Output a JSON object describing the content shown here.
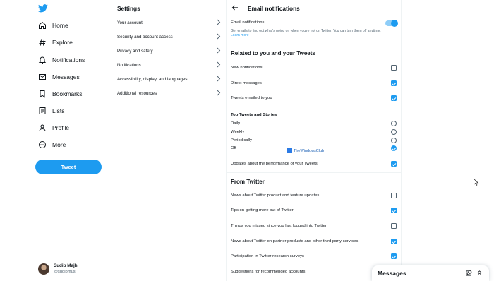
{
  "nav": {
    "items": [
      {
        "label": "Home",
        "icon": "home-icon"
      },
      {
        "label": "Explore",
        "icon": "hashtag-icon"
      },
      {
        "label": "Notifications",
        "icon": "bell-icon"
      },
      {
        "label": "Messages",
        "icon": "envelope-icon"
      },
      {
        "label": "Bookmarks",
        "icon": "bookmark-icon"
      },
      {
        "label": "Lists",
        "icon": "list-icon"
      },
      {
        "label": "Profile",
        "icon": "person-icon"
      },
      {
        "label": "More",
        "icon": "more-circle-icon"
      }
    ],
    "tweet_button": "Tweet",
    "account": {
      "name": "Sudip Majhi",
      "handle": "@sudipmus",
      "more": "···"
    }
  },
  "settings": {
    "title": "Settings",
    "items": [
      "Your account",
      "Security and account access",
      "Privacy and safety",
      "Notifications",
      "Accessibility, display, and languages",
      "Additional resources"
    ]
  },
  "email": {
    "title": "Email notifications",
    "toggle_label": "Email notifications",
    "toggle_on": true,
    "description": "Get emails to find out what's going on when you're not on Twitter. You can turn them off anytime.",
    "learn_more": "Learn more",
    "related": {
      "heading": "Related to you and your Tweets",
      "items": [
        {
          "label": "New notifications",
          "checked": false
        },
        {
          "label": "Direct messages",
          "checked": true
        },
        {
          "label": "Tweets emailed to you",
          "checked": true
        }
      ]
    },
    "top_tweets": {
      "heading": "Top Tweets and Stories",
      "options": [
        {
          "label": "Daily",
          "selected": false
        },
        {
          "label": "Weekly",
          "selected": false
        },
        {
          "label": "Periodically",
          "selected": false
        },
        {
          "label": "Off",
          "selected": true
        }
      ]
    },
    "performance": {
      "label": "Updates about the performance of your Tweets",
      "checked": true
    },
    "from_twitter": {
      "heading": "From Twitter",
      "items": [
        {
          "label": "News about Twitter product and feature updates",
          "checked": false
        },
        {
          "label": "Tips on getting more out of Twitter",
          "checked": true
        },
        {
          "label": "Things you missed since you last logged into Twitter",
          "checked": false
        },
        {
          "label": "News about Twitter on partner products and other third party services",
          "checked": true
        },
        {
          "label": "Participation in Twitter research surveys",
          "checked": true
        },
        {
          "label": "Suggestions for recommended accounts",
          "checked": false
        }
      ]
    }
  },
  "watermark": "TheWindowsClub",
  "messages_drawer": {
    "title": "Messages"
  },
  "colors": {
    "accent": "#1d9bf0",
    "text": "#0f1419",
    "secondary": "#536471",
    "border": "#eff3f4"
  }
}
